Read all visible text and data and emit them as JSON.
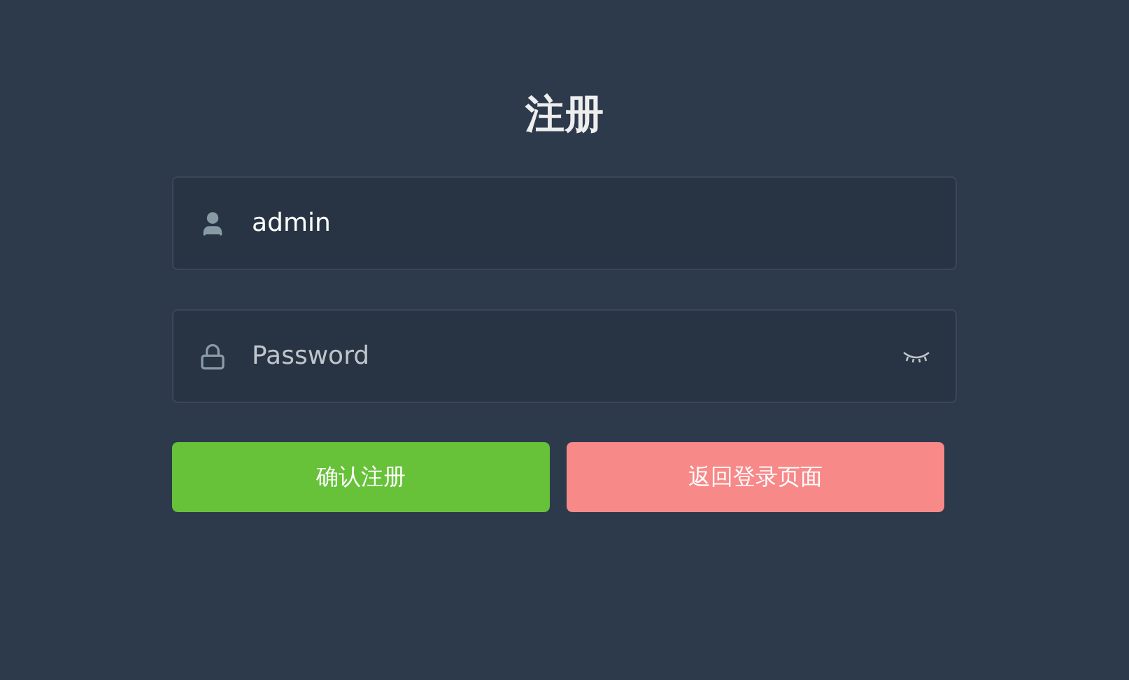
{
  "title": "注册",
  "username": {
    "value": "admin"
  },
  "password": {
    "placeholder": "Password"
  },
  "buttons": [
    {
      "label": "确认注册",
      "kind": "primary"
    },
    {
      "label": "返回登录页面",
      "kind": "danger"
    }
  ]
}
